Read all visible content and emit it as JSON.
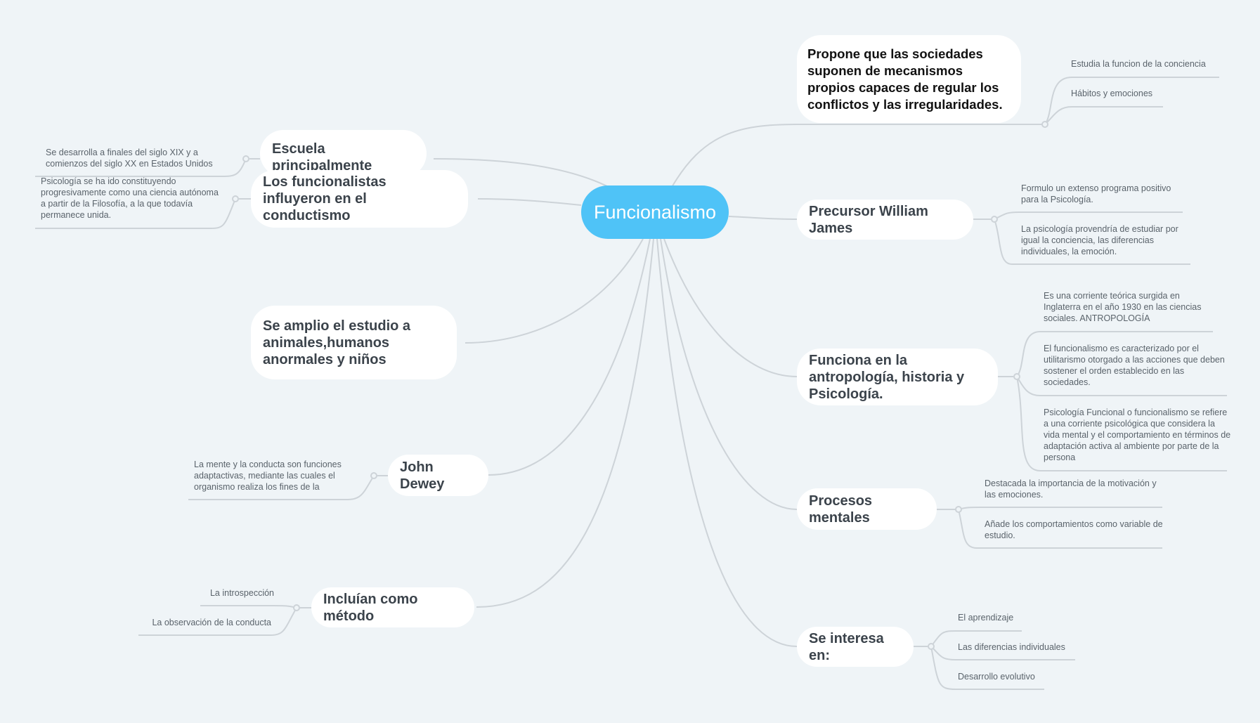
{
  "root": {
    "label": "Funcionalismo",
    "color": "#4fc3f7"
  },
  "branches": {
    "propone": {
      "label": "Propone que las sociedades suponen de mecanismos propios capaces de regular los conflictos y las irregularidades.",
      "children": [
        "Estudia la funcion de la conciencia",
        "Hábitos y emociones"
      ]
    },
    "precursor": {
      "label": "Precursor William James",
      "children": [
        "Formulo un extenso programa positivo para la Psicología.",
        "La psicología provendría de estudiar por igual la conciencia, las diferencias individuales, la emoción."
      ]
    },
    "funciona": {
      "label": "Funciona en la antropología, historia y Psicología.",
      "children": [
        "Es una corriente teórica surgida en Inglaterra en el año 1930 en las ciencias sociales. ANTROPOLOGÍA",
        "El funcionalismo es caracterizado por el utilitarismo otorgado a las acciones que deben sostener el orden establecido en las sociedades.",
        "Psicología Funcional o funcionalismo se refiere a una corriente psicológica que considera la vida mental y el comportamiento en términos de adaptación activa al ambiente por parte de la persona"
      ]
    },
    "procesos": {
      "label": "Procesos mentales",
      "children": [
        "Destacada la importancia de la motivación y  las emociones.",
        "Añade los comportamientos como variable de estudio."
      ]
    },
    "interesa": {
      "label": "Se interesa en:",
      "children": [
        "El aprendizaje",
        "Las diferencias individuales",
        "Desarrollo evolutivo"
      ]
    },
    "escuela": {
      "label": "Escuela principalmente americana",
      "children": [
        "Se desarrolla a finales del siglo XIX y a comienzos del siglo XX en Estados Unidos"
      ]
    },
    "conductismo": {
      "label": "Los funcionalistas influyeron en el conductismo",
      "children": [
        "Psicología se ha ido constituyendo progresivamente como una ciencia autónoma a partir de la Filosofía, a la que todavía permanece unida."
      ]
    },
    "amplio": {
      "label": "Se amplio el estudio a animales,humanos anormales y niños",
      "children": []
    },
    "dewey": {
      "label": "John Dewey",
      "children": [
        "La mente y la conducta son funciones adaptactivas, mediante las cuales el organismo realiza los fines de la"
      ]
    },
    "metodo": {
      "label": "Incluían como método",
      "children": [
        "La introspección",
        "La  observación de la conducta"
      ]
    }
  }
}
